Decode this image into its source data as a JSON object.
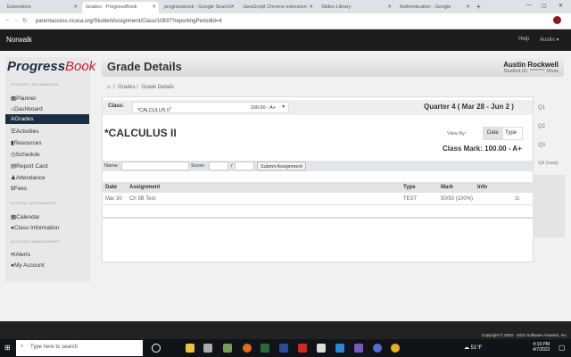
{
  "browser": {
    "tabs": [
      "Extensions",
      "Grades - ProgressBook",
      "progressbook - Google Search",
      "JavaScript Chrome extension",
      "Slides Library",
      "Authentication - Google"
    ],
    "url": "parentaccess.ncoca.org/StudentAssignment/Class/10837?reportingPeriodId=4"
  },
  "nav": {
    "brand": "Norwalk",
    "help": "Help",
    "user": "Austin ▾"
  },
  "sidebar": {
    "logo_a": "Progress",
    "logo_b": "Book",
    "sections": [
      "STUDENT INFORMATION",
      "SCHOOL INFORMATION",
      "ACCOUNT MANAGEMENT"
    ],
    "items": [
      {
        "icon": "▦",
        "label": "Planner"
      },
      {
        "icon": "⌂",
        "label": "Dashboard"
      },
      {
        "icon": "A",
        "label": "Grades"
      },
      {
        "icon": "☰",
        "label": "Activities"
      },
      {
        "icon": "▮",
        "label": "Resources"
      },
      {
        "icon": "◷",
        "label": "Schedule"
      },
      {
        "icon": "▤",
        "label": "Report Card"
      },
      {
        "icon": "♟",
        "label": "Attendance"
      },
      {
        "icon": "$",
        "label": "Fees"
      },
      {
        "icon": "▦",
        "label": "Calendar"
      },
      {
        "icon": "●",
        "label": "Class Information"
      },
      {
        "icon": "✉",
        "label": "Alerts"
      },
      {
        "icon": "●",
        "label": "My Account"
      }
    ]
  },
  "header": {
    "title": "Grade Details",
    "student_name": "Austin Rockwell",
    "student_id": "Student ID: ******** Show"
  },
  "breadcrumb": {
    "home": "⌂",
    "grades": "Grades",
    "current": "Grade Details"
  },
  "class_row": {
    "label": "Class:",
    "selected": "*CALCULUS II",
    "sup": "1",
    "mark": "100.00 - A+",
    "quarter": "Quarter 4 ( Mar 28 - Jun 2 )"
  },
  "course": {
    "title": "*CALCULUS II",
    "view_by": "View By:",
    "date": "Date",
    "type": "Type",
    "class_mark": "Class Mark: 100.00 - A+"
  },
  "form": {
    "name_label": "Name:",
    "score_label": "Score:",
    "slash": "/",
    "submit": "Submit Assignment"
  },
  "table": {
    "headers": [
      "Date",
      "Assignment",
      "Type",
      "Mark",
      "Info"
    ],
    "rows": [
      {
        "date": "Mar 30",
        "assignment": "Ch 9B Test",
        "type": "TEST",
        "mark": "50/50  (100%)"
      }
    ]
  },
  "quarters": [
    "Q1",
    "Q2",
    "Q3",
    "Q4 (now)"
  ],
  "footer": {
    "copyright": "Copyright © 2003 - 2022 Software Answers, Inc."
  },
  "taskbar": {
    "search": "Type here to search",
    "weather": "51°F",
    "time": "4:19 PM",
    "date": "4/7/2022"
  }
}
